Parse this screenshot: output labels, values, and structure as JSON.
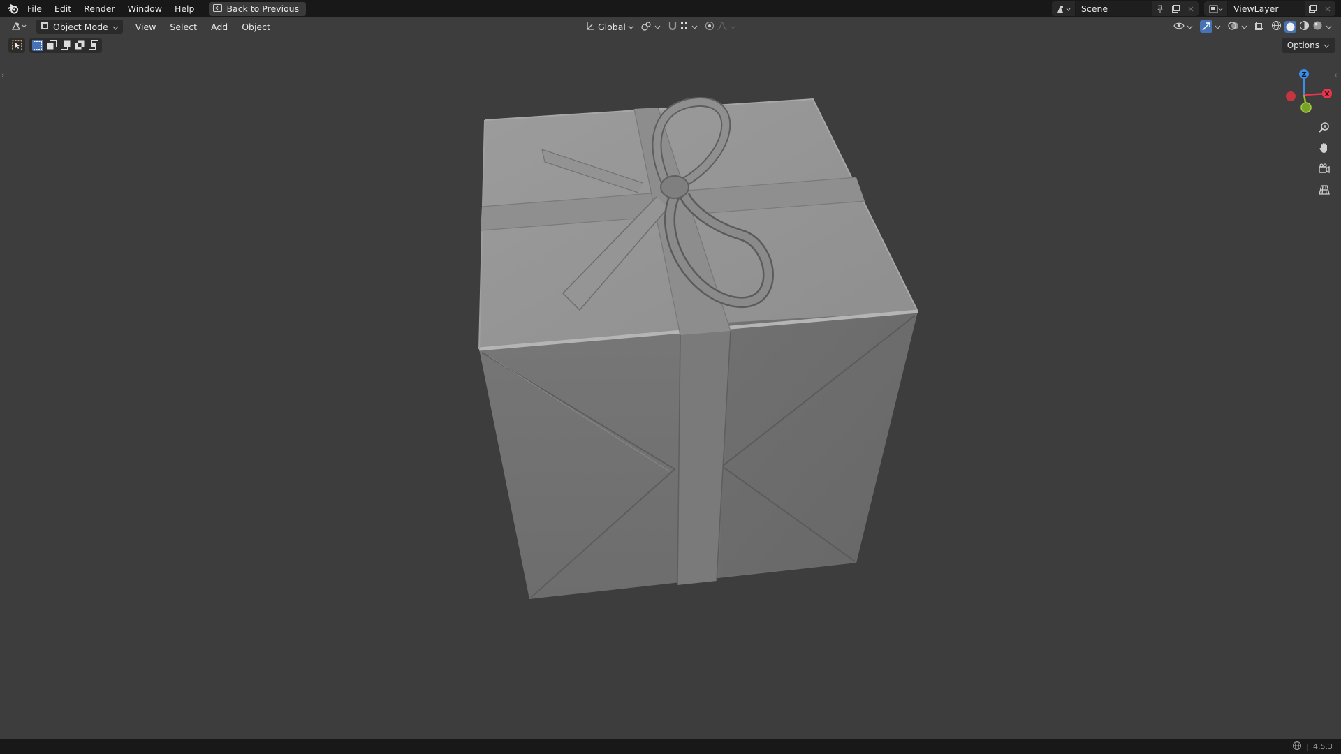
{
  "topbar": {
    "menu": [
      "File",
      "Edit",
      "Render",
      "Window",
      "Help"
    ],
    "back_label": "Back to Previous",
    "scene_name": "Scene",
    "view_layer_name": "ViewLayer"
  },
  "header": {
    "mode_label": "Object Mode",
    "menus": [
      "View",
      "Select",
      "Add",
      "Object"
    ],
    "orientation_label": "Global"
  },
  "viewport": {
    "options_label": "Options",
    "gizmo_axes": [
      "Z",
      "X",
      "Y"
    ]
  },
  "statusbar": {
    "version": "4.5.3"
  },
  "colors": {
    "accent": "#4772b3",
    "axis_x": "#e8354d",
    "axis_y": "#8fbc2b",
    "axis_z": "#3b8ee8"
  }
}
